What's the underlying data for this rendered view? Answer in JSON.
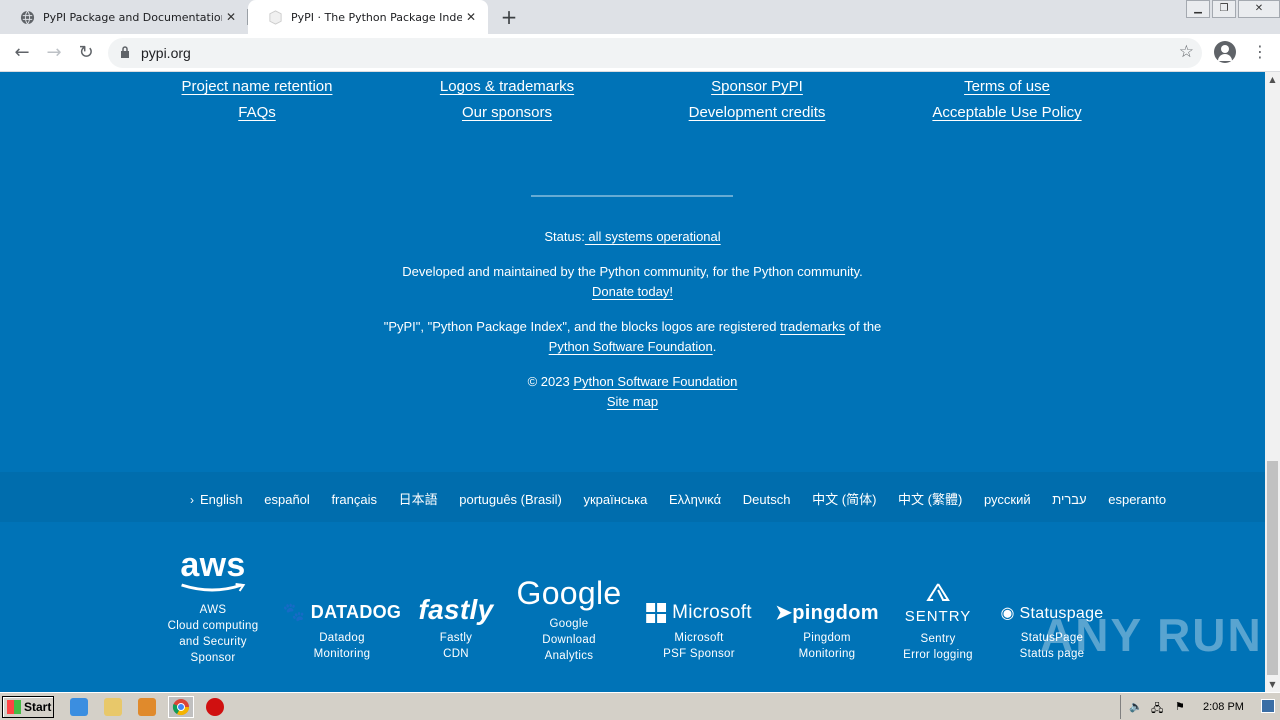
{
  "browser": {
    "tabs": [
      {
        "title": "PyPI Package and Documentation St",
        "active": false
      },
      {
        "title": "PyPI · The Python Package Index",
        "active": true
      }
    ],
    "url": "pypi.org"
  },
  "footer": {
    "links": [
      [
        "Project name retention",
        "FAQs"
      ],
      [
        "Logos & trademarks",
        "Our sponsors"
      ],
      [
        "Sponsor PyPI",
        "Development credits"
      ],
      [
        "Terms of use",
        "Acceptable Use Policy"
      ]
    ],
    "status_label": "Status:",
    "status_link": " all systems operational",
    "maintained_text": "Developed and maintained by the Python community, for the Python community.",
    "donate_link": "Donate today!",
    "trademark_prefix": "\"PyPI\", \"Python Package Index\", and the blocks logos are registered ",
    "trademark_link": "trademarks",
    "trademark_suffix": " of the",
    "psf_link": "Python Software Foundation",
    "period": ".",
    "copyright_prefix": "© 2023 ",
    "copyright_link": "Python Software Foundation",
    "sitemap_link": "Site map"
  },
  "languages": [
    "English",
    "español",
    "français",
    "日本語",
    "português (Brasil)",
    "українська",
    "Ελληνικά",
    "Deutsch",
    "中文 (简体)",
    "中文 (繁體)",
    "русский",
    "עברית",
    "esperanto"
  ],
  "sponsors": [
    {
      "logo": "aws",
      "lines": [
        "AWS",
        "Cloud computing",
        "and Security",
        "Sponsor"
      ]
    },
    {
      "logo": "DATADOG",
      "lines": [
        "Datadog",
        "Monitoring"
      ]
    },
    {
      "logo": "fastly",
      "lines": [
        "Fastly",
        "CDN"
      ]
    },
    {
      "logo": "Google",
      "lines": [
        "Google",
        "Download",
        "Analytics"
      ]
    },
    {
      "logo": "Microsoft",
      "lines": [
        "Microsoft",
        "PSF Sponsor"
      ]
    },
    {
      "logo": "pingdom",
      "lines": [
        "Pingdom",
        "Monitoring"
      ]
    },
    {
      "logo": "SENTRY",
      "lines": [
        "Sentry",
        "Error logging"
      ]
    },
    {
      "logo": "Statuspage",
      "lines": [
        "StatusPage",
        "Status page"
      ]
    }
  ],
  "watermark": "ANY RUN",
  "taskbar": {
    "start": "Start",
    "clock": "2:08 PM"
  },
  "colors": {
    "page_bg": "#0073b7",
    "lang_bar_bg": "#006dad"
  }
}
